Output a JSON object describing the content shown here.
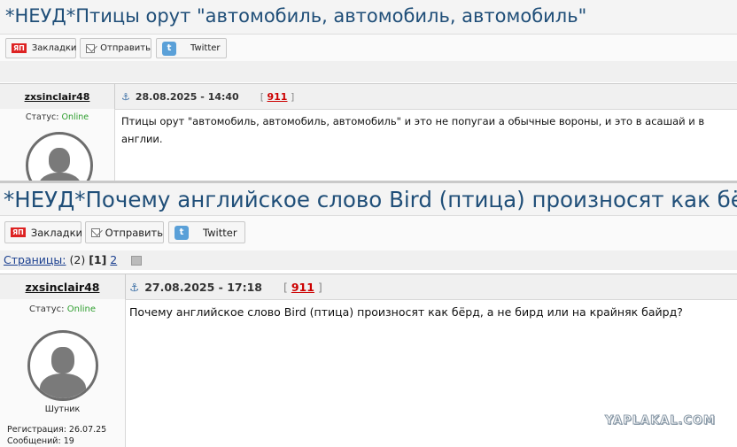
{
  "topic1": {
    "title": "*НЕУД*Птицы орут \"автомобиль, автомобиль, автомобиль\"",
    "share": {
      "bookmarks": "Закладки",
      "send": "Отправить",
      "twitter": "Twitter",
      "yap_icon": "ЯП"
    },
    "post": {
      "author": "zxsinclair48",
      "date": "28.08.2025 - 14:40",
      "number": "911",
      "status_label": "Статус:",
      "status_value": "Online",
      "text": "Птицы орут \"автомобиль, автомобиль, автомобиль\" и это не попугаи а обычные вороны, и это в асашай и в англии."
    }
  },
  "topic2": {
    "title": "*НЕУД*Почему английское слово Bird (птица) произносят как бёрд, а не бирд или на крайняк байрд?",
    "share": {
      "bookmarks": "Закладки",
      "send": "Отправить",
      "twitter": "Twitter",
      "yap_icon": "ЯП"
    },
    "pager": {
      "label": "Страницы:",
      "count": "(2)",
      "current": "[1]",
      "next": "2"
    },
    "post": {
      "author": "zxsinclair48",
      "date": "27.08.2025 - 17:18",
      "number": "911",
      "status_label": "Статус:",
      "status_value": "Online",
      "rank": "Шутник",
      "registration": "Регистрация: 26.07.25",
      "messages": "Сообщений: 19",
      "text": "Почему английское слово Bird (птица) произносят как бёрд, а не бирд или на крайняк байрд?"
    }
  },
  "watermark": "YAPLAKAL.COM",
  "colors": {
    "title": "#1f4e78",
    "online": "#2e9e2e",
    "post_number": "#c00000"
  }
}
